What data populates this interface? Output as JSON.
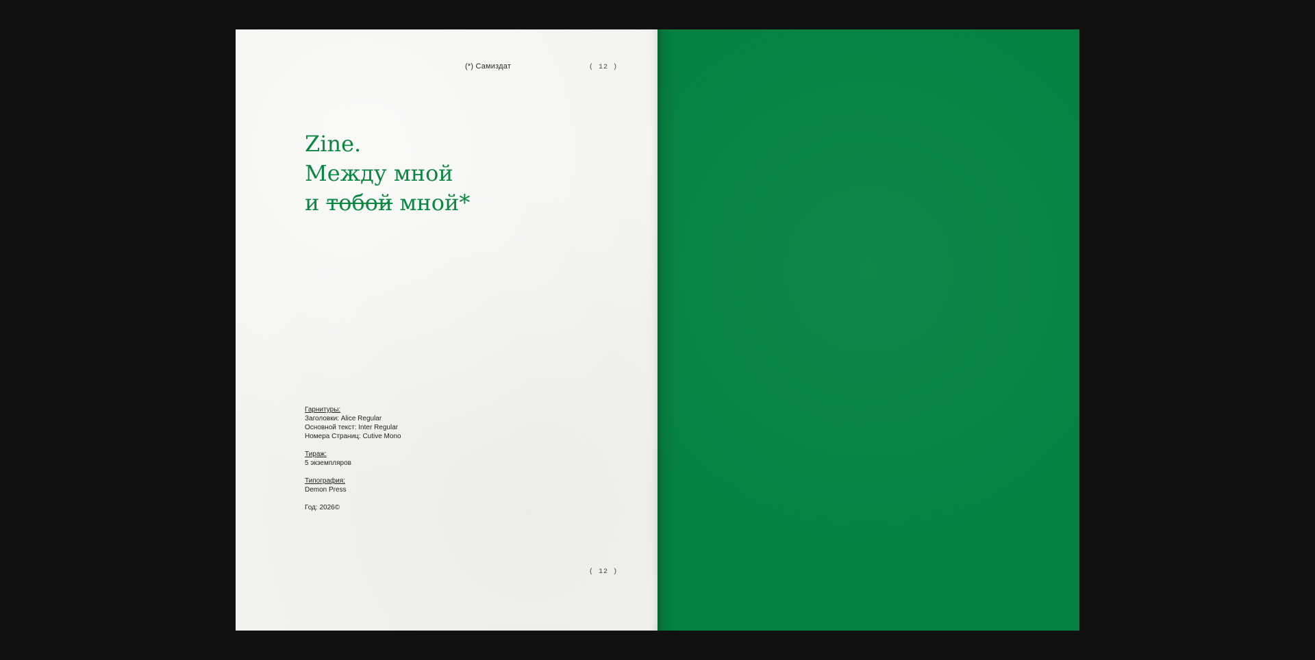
{
  "left_page": {
    "header": "(*) Самиздат",
    "page_number_top": "( 12 )",
    "page_number_bottom": "( 12 )",
    "title": {
      "line1": "Zine.",
      "line2": "Между мной",
      "line3_prefix": "и",
      "line3_struck": "тобой",
      "line3_suffix": "мной*"
    },
    "colophon": {
      "typefaces_label": "Гарнитуры:",
      "typefaces": [
        "Заголовки: Alice Regular",
        "Основной текст: Inter Regular",
        "Номера Страниц: Cutive Mono"
      ],
      "edition_label": "Тираж:",
      "edition_value": "5 экземпляров",
      "printer_label": "Типография:",
      "printer_value": "Demon Press",
      "year": "Год: 2026©"
    }
  },
  "colors": {
    "background": "#111111",
    "paper": "#f3f3f1",
    "accent_green": "#0b8742",
    "right_page_green": "#048242"
  }
}
